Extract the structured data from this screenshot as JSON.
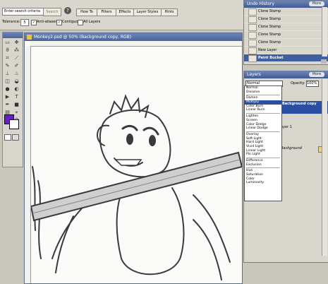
{
  "search": {
    "placeholder": "Enter search criteria",
    "button": "Search"
  },
  "palette_tabs": [
    "How To",
    "Filters",
    "Effects",
    "Layer Styles",
    "Hints"
  ],
  "options": {
    "tolerance_label": "Tolerance:",
    "tolerance_value": "5",
    "anti_aliased": "Anti-aliased",
    "contiguous": "Contiguous",
    "all_layers": "All Layers"
  },
  "document": {
    "title": "Monkey2.psd @ 50% (Background copy, RGB)"
  },
  "history": {
    "title": "Undo History",
    "more": "More",
    "items": [
      "Clone Stamp",
      "Clone Stamp",
      "Clone Stamp",
      "Clone Stamp",
      "Clone Stamp",
      "New Layer",
      "Paint Bucket"
    ]
  },
  "layers": {
    "title": "Layers",
    "more": "More",
    "blend_value": "Normal",
    "opacity_label": "Opacity:",
    "opacity_value": "100%",
    "rows": [
      "Background copy",
      "ayer 1",
      "Background"
    ]
  },
  "blend_modes": [
    [
      "Normal",
      "Dissolve"
    ],
    [
      "Darken",
      "Multiply",
      "Color Burn",
      "Linear Burn"
    ],
    [
      "Lighten",
      "Screen",
      "Color Dodge",
      "Linear Dodge"
    ],
    [
      "Overlay",
      "Soft Light",
      "Hard Light",
      "Vivid Light",
      "Linear Light",
      "Pin Light"
    ],
    [
      "Difference",
      "Exclusion"
    ],
    [
      "Hue",
      "Saturation",
      "Color",
      "Luminosity"
    ]
  ],
  "blend_selected": "Multiply",
  "colors": {
    "foreground": "#6a1ec9",
    "background": "#ffffff",
    "title_bar": "#4a6499",
    "selection": "#2b4fa4"
  }
}
